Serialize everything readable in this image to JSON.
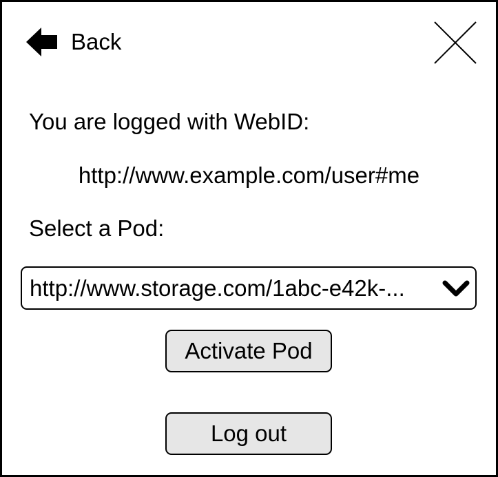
{
  "header": {
    "back_label": "Back",
    "back_icon": "arrow-left-icon",
    "close_icon": "close-icon"
  },
  "session": {
    "logged_label": "You are logged with WebID:",
    "webid": "http://www.example.com/user#me"
  },
  "pod": {
    "select_label": "Select a Pod:",
    "selected_value": "http://www.storage.com/1abc-e42k-...",
    "dropdown_icon": "chevron-down-icon"
  },
  "actions": {
    "activate_label": "Activate Pod",
    "logout_label": "Log out"
  },
  "colors": {
    "button_background": "#e6e6e6",
    "border": "#000000",
    "text": "#000000",
    "background": "#ffffff"
  }
}
